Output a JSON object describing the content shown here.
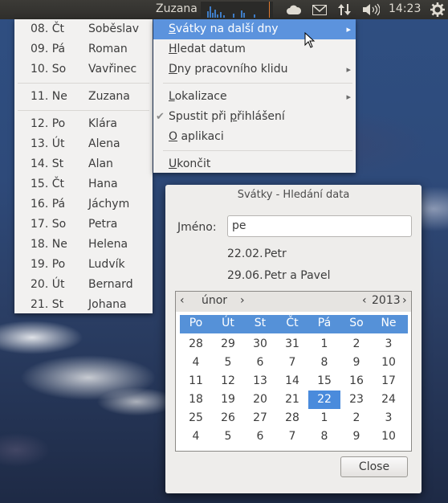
{
  "panel": {
    "username": "Zuzana",
    "clock": "14:23",
    "icons": [
      "cloud-icon",
      "mail-icon",
      "network-updown-icon",
      "volume-icon",
      "gear-icon"
    ]
  },
  "holidays": [
    {
      "date": "08. Čt",
      "name": "Soběslav"
    },
    {
      "date": "09. Pá",
      "name": "Roman"
    },
    {
      "date": "10. So",
      "name": "Vavřinec"
    },
    {
      "date": "11. Ne",
      "name": "Zuzana"
    },
    {
      "date": "12. Po",
      "name": "Klára"
    },
    {
      "date": "13. Út",
      "name": "Alena"
    },
    {
      "date": "14. St",
      "name": "Alan"
    },
    {
      "date": "15. Čt",
      "name": "Hana"
    },
    {
      "date": "16. Pá",
      "name": "Jáchym"
    },
    {
      "date": "17. So",
      "name": "Petra"
    },
    {
      "date": "18. Ne",
      "name": "Helena"
    },
    {
      "date": "19. Po",
      "name": "Ludvík"
    },
    {
      "date": "20. Út",
      "name": "Bernard"
    },
    {
      "date": "21. St",
      "name": "Johana"
    }
  ],
  "menu": {
    "item0_mnemonic": "S",
    "item0_rest": "vátky na další dny",
    "item1_mnemonic": "H",
    "item1_rest": "ledat datum",
    "item2_mnemonic": "D",
    "item2_rest": "ny pracovního klidu",
    "item3_mnemonic": "L",
    "item3_rest": "okalizace",
    "item4_pre": "Spustit při ",
    "item4_mnemonic": "p",
    "item4_rest": "řihlášení",
    "item5_mnemonic": "O",
    "item5_rest": " aplikaci",
    "item6_mnemonic": "U",
    "item6_rest": "končit"
  },
  "dialog": {
    "title": "Svátky - Hledání data",
    "name_label": "Jméno:",
    "name_value": "pe",
    "results": [
      {
        "date": "22.02.",
        "name": "Petr"
      },
      {
        "date": "29.06.",
        "name": "Petr a Pavel"
      }
    ],
    "calendar": {
      "month": "únor",
      "year": "2013",
      "weekdays": [
        "Po",
        "Út",
        "St",
        "Čt",
        "Pá",
        "So",
        "Ne"
      ],
      "weeks": [
        [
          "28",
          "29",
          "30",
          "31",
          "1",
          "2",
          "3"
        ],
        [
          "4",
          "5",
          "6",
          "7",
          "8",
          "9",
          "10"
        ],
        [
          "11",
          "12",
          "13",
          "14",
          "15",
          "16",
          "17"
        ],
        [
          "18",
          "19",
          "20",
          "21",
          "22",
          "23",
          "24"
        ],
        [
          "25",
          "26",
          "27",
          "28",
          "1",
          "2",
          "3"
        ],
        [
          "4",
          "5",
          "6",
          "7",
          "8",
          "9",
          "10"
        ]
      ],
      "selected_day": "22"
    },
    "close_label": "Close"
  }
}
